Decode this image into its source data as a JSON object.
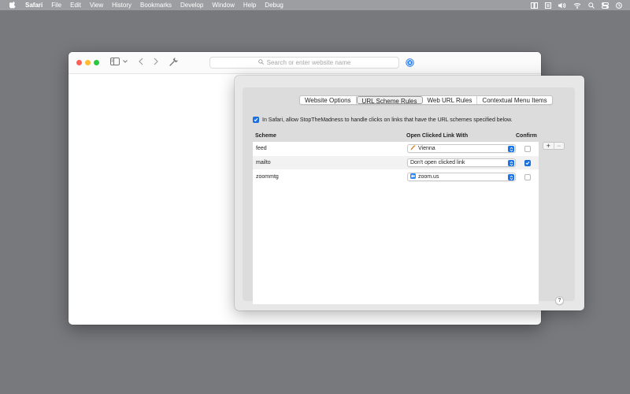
{
  "menubar": {
    "items": [
      "Safari",
      "File",
      "Edit",
      "View",
      "History",
      "Bookmarks",
      "Develop",
      "Window",
      "Help",
      "Debug"
    ],
    "right_icons": [
      "split-view-icon",
      "reader-icon",
      "volume-icon",
      "wifi-icon",
      "search-icon",
      "control-center-icon",
      "clock-icon"
    ]
  },
  "browser": {
    "address_placeholder": "Search or enter website name"
  },
  "extension": {
    "tabs": [
      "Website Options",
      "URL Scheme Rules",
      "Web URL Rules",
      "Contextual Menu Items"
    ],
    "active_tab": "URL Scheme Rules",
    "allow_label": "In Safari, allow StopTheMadness to handle clicks on links that have the URL schemes specified below.",
    "allow_checked": true,
    "columns": {
      "scheme": "Scheme",
      "open_with": "Open Clicked Link With",
      "confirm": "Confirm"
    },
    "rows": [
      {
        "scheme": "feed",
        "open_with": "Vienna",
        "app_icon": "vienna-icon",
        "confirm": false
      },
      {
        "scheme": "mailto",
        "open_with": "Don't open clicked link",
        "app_icon": "",
        "confirm": true
      },
      {
        "scheme": "zoommtg",
        "open_with": "zoom.us",
        "app_icon": "zoom-icon",
        "confirm": false
      }
    ],
    "add_label": "+",
    "remove_label": "−",
    "help_label": "?"
  },
  "colors": {
    "accent": "#1a73e8",
    "desktop": "#78797d",
    "menubar": "#9d9ea2"
  }
}
